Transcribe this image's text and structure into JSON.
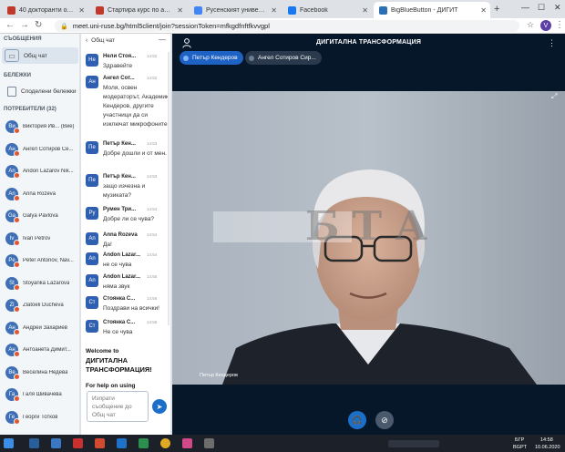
{
  "browser": {
    "tabs": [
      {
        "title": "40 докторанти от Русенски",
        "color": "#c0392b"
      },
      {
        "title": "Стартира курс по английск",
        "color": "#c0392b"
      },
      {
        "title": "Русенският университет д",
        "color": "#4285f4"
      },
      {
        "title": "Facebook",
        "color": "#1877f2"
      },
      {
        "title": "BigBlueButton - ДИГИТ",
        "color": "#2b6fb5"
      }
    ],
    "url": "meet.uni-ruse.bg/html5client/join?sessionToken=mfkgdfnftfkvvgpl",
    "account_initial": "V"
  },
  "sidebar": {
    "messages_label": "СЪОБЩЕНИЯ",
    "public_chat_label": "Общ чат",
    "notes_section_label": "БЕЛЕЖКИ",
    "shared_notes_label": "Споделени бележки",
    "users_label": "ПОТРЕБИТЕЛИ (32)",
    "users": [
      {
        "initials": "Ви",
        "name": "Виктория Ив... (Вие)",
        "color": "#3f6fb5"
      },
      {
        "initials": "Ан",
        "name": "Ангел Сотиров Се...",
        "color": "#3f6fb5"
      },
      {
        "initials": "An",
        "name": "Andon Lazarov Nik...",
        "color": "#3f6fb5"
      },
      {
        "initials": "An",
        "name": "Anna Rozeva",
        "color": "#3f6fb5"
      },
      {
        "initials": "Ga",
        "name": "Galya Pavlova",
        "color": "#3f6fb5"
      },
      {
        "initials": "Iv",
        "name": "Ivan Petrov",
        "color": "#3f6fb5"
      },
      {
        "initials": "Pe",
        "name": "Peter Antonov, Nav...",
        "color": "#3f6fb5"
      },
      {
        "initials": "St",
        "name": "Stoyanka Lazarova",
        "color": "#3f6fb5"
      },
      {
        "initials": "Zl",
        "name": "Zlatoeli Ducheva",
        "color": "#3f6fb5"
      },
      {
        "initials": "Ан",
        "name": "Андрей Захариев",
        "color": "#3f6fb5"
      },
      {
        "initials": "Ан",
        "name": "Антоанета Димит...",
        "color": "#3f6fb5"
      },
      {
        "initials": "Ве",
        "name": "Веселина Недева",
        "color": "#3f6fb5"
      },
      {
        "initials": "Га",
        "name": "Галя Шивачева",
        "color": "#3f6fb5"
      },
      {
        "initials": "Ге",
        "name": "Георги Тотков",
        "color": "#3f6fb5"
      }
    ]
  },
  "chat": {
    "header": "Общ чат",
    "messages": [
      {
        "initials": "Не",
        "name": "Нели Стоя...",
        "time": "14:52",
        "text": "Здравейте",
        "color": "#2f5fb0"
      },
      {
        "initials": "Ан",
        "name": "Ангел Сот...",
        "time": "14:52",
        "text": "Моля, освен модераторът, Академик Кендеров, другите участници да си изключат микрофоните!",
        "color": "#2f5fb0"
      },
      {
        "initials": "Пе",
        "name": "Петър Кен...",
        "time": "14:53",
        "text": "Добре дошли и от мен.",
        "color": "#2f5fb0"
      },
      {
        "initials": "Пе",
        "name": "Петър Кен...",
        "time": "14:53",
        "text": "защо изчезна и музиката?",
        "color": "#2f5fb0"
      },
      {
        "initials": "Ру",
        "name": "Румен Три...",
        "time": "14:54",
        "text": "Добре ли се чува?",
        "color": "#2f5fb0"
      },
      {
        "initials": "An",
        "name": "Anna Rozeva",
        "time": "14:54",
        "text": "Да!",
        "color": "#2f5fb0"
      },
      {
        "initials": "An",
        "name": "Andon Lazar...",
        "time": "14:54",
        "text": "не се чува",
        "color": "#2f5fb0"
      },
      {
        "initials": "An",
        "name": "Andon Lazar...",
        "time": "14:55",
        "text": "няма звук",
        "color": "#2f5fb0"
      },
      {
        "initials": "Ст",
        "name": "Стоянка С...",
        "time": "14:56",
        "text": "Поздрави на всички!",
        "color": "#2f5fb0"
      },
      {
        "initials": "Ст",
        "name": "Стоянка С...",
        "time": "14:56",
        "text": "Не се чува",
        "color": "#2f5fb0"
      }
    ],
    "welcome_line1": "Welcome to",
    "welcome_line2": "ДИГИТАЛНА ТРАНСФОРМАЦИЯ!",
    "help_text": "For help on using",
    "input_placeholder": "Изпрати съобщение до Общ чат"
  },
  "stage": {
    "title": "ДИГИТАЛНА ТРАНСФОРМАЦИЯ",
    "speakers": [
      {
        "name": "Петър Кендеров",
        "active": true
      },
      {
        "name": "Ангел Сотиров Сир...",
        "active": false
      }
    ],
    "video_label": "Петър Кендеров",
    "watermark": "БТА"
  },
  "taskbar": {
    "lang": "БГР",
    "lang_sub": "BGPT",
    "time": "14:58",
    "date": "10.06.2020"
  }
}
